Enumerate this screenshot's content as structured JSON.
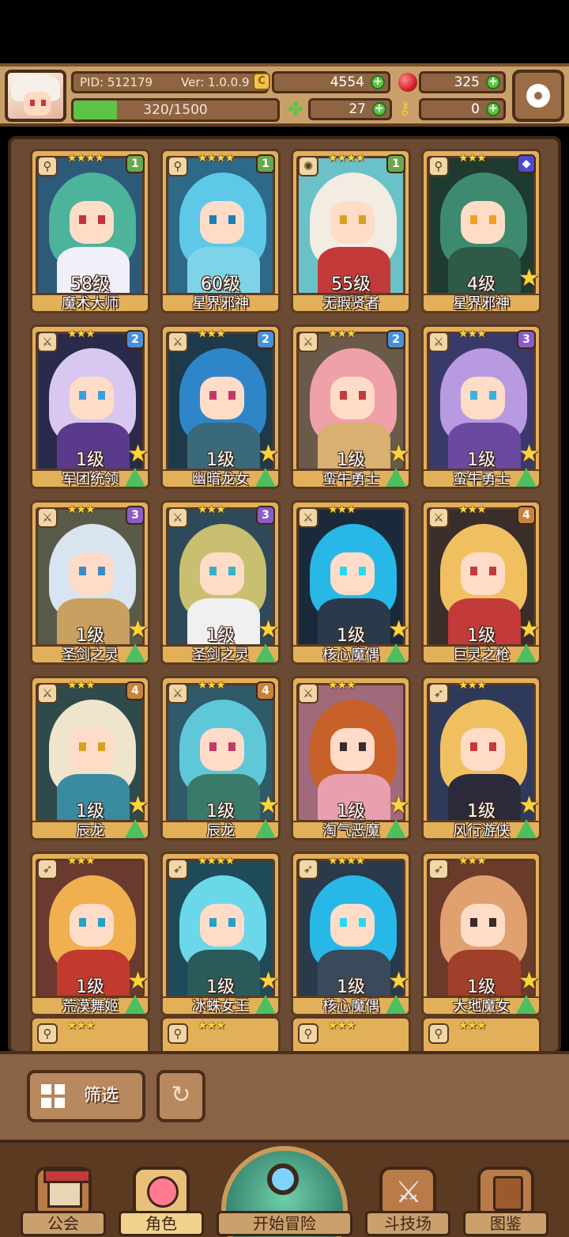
{
  "header": {
    "pid": "PID: 512179",
    "version": "Ver: 1.0.0.9",
    "gold": "4554",
    "gems": "325",
    "exp": "320/1500",
    "exp_progress": 0.213,
    "clovers": "27",
    "keys": "0",
    "coin_icon_glyph": "C"
  },
  "heroes": [
    {
      "level": "58级",
      "name": "魔术大师",
      "rank": "1",
      "stars": "★★★★",
      "class": "staff",
      "colors": {
        "bg": "#2e5a7a",
        "hair": "#4db39a",
        "body": "#f0f0f8",
        "eye": "#c2333a"
      },
      "favorite": false,
      "upgradable": false
    },
    {
      "level": "60级",
      "name": "星界邪神",
      "rank": "1",
      "stars": "★★★★",
      "class": "staff",
      "colors": {
        "bg": "#2d6a88",
        "hair": "#5ec8e8",
        "body": "#7fd3e8",
        "eye": "#1e7fb0"
      },
      "favorite": false,
      "upgradable": false
    },
    {
      "level": "55级",
      "name": "无瑕贤者",
      "rank": "1",
      "stars": "★★★★",
      "class": "orb",
      "colors": {
        "bg": "#6ac2c8",
        "hair": "#f2ece2",
        "body": "#c23a3a",
        "eye": "#d8a020"
      },
      "favorite": false,
      "upgradable": false
    },
    {
      "level": "4级",
      "name": "星界邪神",
      "rank": "◆",
      "stars": "★★★",
      "class": "staff",
      "colors": {
        "bg": "#1f3a2e",
        "hair": "#3e8a6e",
        "body": "#2e5a48",
        "eye": "#f2a020"
      },
      "favorite": true,
      "upgradable": false
    },
    {
      "level": "1级",
      "name": "军团统领",
      "rank": "2",
      "stars": "★★★",
      "class": "sword",
      "colors": {
        "bg": "#2a2a4a",
        "hair": "#d8c8f0",
        "body": "#5a3a8a",
        "eye": "#3aa0e0"
      },
      "favorite": true,
      "upgradable": true
    },
    {
      "level": "1级",
      "name": "幽暗龙女",
      "rank": "2",
      "stars": "★★★",
      "class": "sword",
      "colors": {
        "bg": "#1e3a4a",
        "hair": "#2e86c8",
        "body": "#3a6a7a",
        "eye": "#c23a6a"
      },
      "favorite": true,
      "upgradable": true
    },
    {
      "level": "1级",
      "name": "蛮牛勇士",
      "rank": "2",
      "stars": "★★★",
      "class": "sword",
      "colors": {
        "bg": "#6a5a4a",
        "hair": "#f0a0a8",
        "body": "#d8b070",
        "eye": "#c23a3a"
      },
      "favorite": true,
      "upgradable": true
    },
    {
      "level": "1级",
      "name": "蛮牛勇士",
      "rank": "3",
      "stars": "★★★",
      "class": "sword",
      "colors": {
        "bg": "#3a3a6a",
        "hair": "#b89ae0",
        "body": "#6a4aa0",
        "eye": "#3ab0e0"
      },
      "favorite": true,
      "upgradable": true
    },
    {
      "level": "1级",
      "name": "圣剑之灵",
      "rank": "3",
      "stars": "★★★",
      "class": "sword",
      "colors": {
        "bg": "#5a5a4a",
        "hair": "#d8e4f0",
        "body": "#c8a060",
        "eye": "#3a8ac8"
      },
      "favorite": true,
      "upgradable": true
    },
    {
      "level": "1级",
      "name": "圣剑之灵",
      "rank": "3",
      "stars": "★★★",
      "class": "sword",
      "colors": {
        "bg": "#2e4a5a",
        "hair": "#c8c070",
        "body": "#f0f0f0",
        "eye": "#3ab0c8"
      },
      "favorite": true,
      "upgradable": true
    },
    {
      "level": "1级",
      "name": "核心魔偶",
      "rank": "",
      "stars": "★★★",
      "class": "sword",
      "colors": {
        "bg": "#1a2a3a",
        "hair": "#28b8e8",
        "body": "#2a3a4a",
        "eye": "#28d8f0"
      },
      "favorite": true,
      "upgradable": true
    },
    {
      "level": "1级",
      "name": "巨灵之枪",
      "rank": "4",
      "stars": "★★★",
      "class": "sword",
      "colors": {
        "bg": "#3a2e2a",
        "hair": "#f0c060",
        "body": "#c23a3a",
        "eye": "#c23a3a"
      },
      "favorite": true,
      "upgradable": true
    },
    {
      "level": "1级",
      "name": "辰龙",
      "rank": "4",
      "stars": "★★★",
      "class": "sword",
      "colors": {
        "bg": "#2e4a4a",
        "hair": "#efe4cc",
        "body": "#3a8aa0",
        "eye": "#d8a020"
      },
      "favorite": true,
      "upgradable": true
    },
    {
      "level": "1级",
      "name": "辰龙",
      "rank": "4",
      "stars": "★★★",
      "class": "sword",
      "colors": {
        "bg": "#2e5a6a",
        "hair": "#5ec8d8",
        "body": "#3a7a6a",
        "eye": "#c23a6a"
      },
      "favorite": true,
      "upgradable": true
    },
    {
      "level": "1级",
      "name": "淘气恶魔",
      "rank": "",
      "stars": "★★★",
      "class": "sword",
      "colors": {
        "bg": "#a06a7a",
        "hair": "#c8602a",
        "body": "#e8a0b0",
        "eye": "#3a2a2a"
      },
      "favorite": true,
      "upgradable": true
    },
    {
      "level": "1级",
      "name": "风行游侠",
      "rank": "",
      "stars": "★★★",
      "class": "bow",
      "colors": {
        "bg": "#2e3a5a",
        "hair": "#f0c060",
        "body": "#2a2a3a",
        "eye": "#c23a3a"
      },
      "favorite": true,
      "upgradable": true
    },
    {
      "level": "1级",
      "name": "荒漠舞姬",
      "rank": "",
      "stars": "★★★",
      "class": "bow",
      "colors": {
        "bg": "#6a3a2e",
        "hair": "#f0b050",
        "body": "#c23a2e",
        "eye": "#28a0c8"
      },
      "favorite": true,
      "upgradable": true
    },
    {
      "level": "1级",
      "name": "冰蛛女王",
      "rank": "",
      "stars": "★★★★",
      "class": "bow",
      "colors": {
        "bg": "#1e4a5a",
        "hair": "#6ad8e8",
        "body": "#2a5a5a",
        "eye": "#28a0c8"
      },
      "favorite": true,
      "upgradable": true
    },
    {
      "level": "1级",
      "name": "核心魔偶",
      "rank": "",
      "stars": "★★★★",
      "class": "bow",
      "colors": {
        "bg": "#2a3a4a",
        "hair": "#28b8e8",
        "body": "#3a4a5a",
        "eye": "#28d8f0"
      },
      "favorite": true,
      "upgradable": true
    },
    {
      "level": "1级",
      "name": "大地魔女",
      "rank": "",
      "stars": "★★★",
      "class": "bow",
      "colors": {
        "bg": "#6a3a2a",
        "hair": "#e0a070",
        "body": "#a0402a",
        "eye": "#3a2a2a"
      },
      "favorite": true,
      "upgradable": true
    }
  ],
  "peek_row_stars": [
    "★★★",
    "★★★",
    "★★★",
    "★★★"
  ],
  "rank_colors": {
    "1": "#6aa84f",
    "2": "#4a90d9",
    "3": "#8a5cc8",
    "4": "#c8843a",
    "◆": "#4a4ad0"
  },
  "controls": {
    "filter_label": "筛选",
    "refresh_glyph": "↻"
  },
  "nav": [
    {
      "label": "公会",
      "icon": "guild-hall-icon"
    },
    {
      "label": "角色",
      "icon": "character-icon"
    },
    {
      "label": "开始冒险",
      "icon": "adventure-globe-icon"
    },
    {
      "label": "斗技场",
      "icon": "crossed-swords-icon"
    },
    {
      "label": "图鉴",
      "icon": "codex-book-icon"
    }
  ]
}
